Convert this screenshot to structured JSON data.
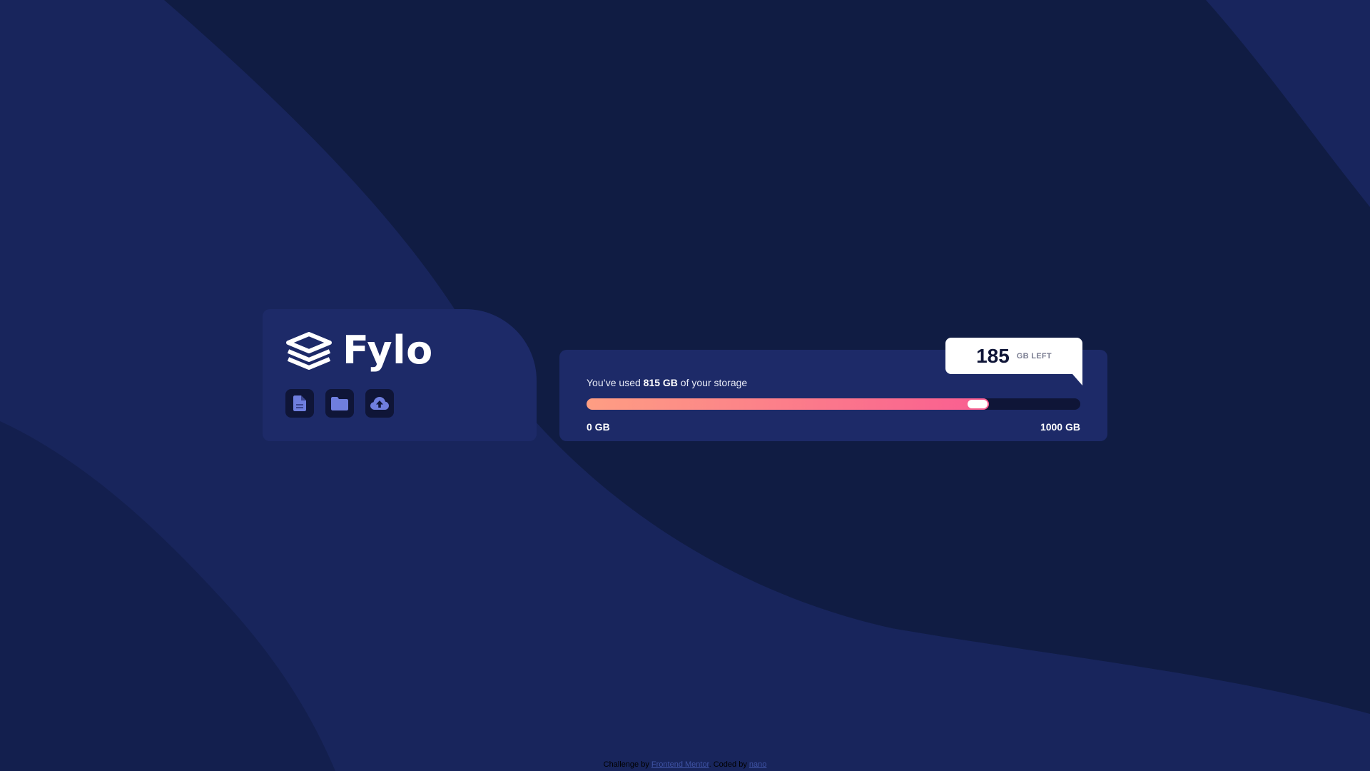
{
  "brand": {
    "name": "Fylo",
    "logo_icon": "layers-icon",
    "actions": [
      {
        "name": "document-icon"
      },
      {
        "name": "folder-icon"
      },
      {
        "name": "upload-cloud-icon"
      }
    ]
  },
  "storage": {
    "text_before": "You’ve used ",
    "used": "815 GB",
    "text_after": " of your storage",
    "min_label": "0 GB",
    "max_label": "1000 GB",
    "used_fraction": 0.815,
    "left_number": "185",
    "left_unit": "GB LEFT"
  },
  "attribution": {
    "prefix": "Challenge by ",
    "link1": "Frontend Mentor",
    "middle": ". Coded by ",
    "link2": "nano"
  },
  "colors": {
    "background": "#101c43",
    "card": "#1d2a68",
    "gradient_start": "#fe9e83",
    "gradient_end": "#f95d91",
    "icon": "#6f7ede"
  }
}
